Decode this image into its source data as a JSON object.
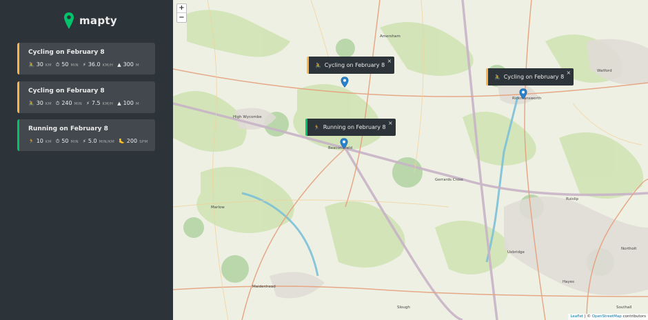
{
  "app": {
    "name": "mapty",
    "accent_cycling": "#ffb545",
    "accent_running": "#00c46a",
    "sidebar_bg": "#2d3439",
    "card_bg": "#42484d"
  },
  "workouts": [
    {
      "type": "cycling",
      "title": "Cycling on February 8",
      "details": [
        {
          "icon": "bike-icon",
          "glyph": "🚴",
          "value": "30",
          "unit": "KM"
        },
        {
          "icon": "stopwatch-icon",
          "glyph": "⏱",
          "value": "50",
          "unit": "MIN"
        },
        {
          "icon": "lightning-icon",
          "glyph": "⚡",
          "value": "36.0",
          "unit": "KM/H"
        },
        {
          "icon": "mountain-icon",
          "glyph": "▲",
          "value": "300",
          "unit": "M"
        }
      ]
    },
    {
      "type": "cycling",
      "title": "Cycling on February 8",
      "details": [
        {
          "icon": "bike-icon",
          "glyph": "🚴",
          "value": "30",
          "unit": "KM"
        },
        {
          "icon": "stopwatch-icon",
          "glyph": "⏱",
          "value": "240",
          "unit": "MIN"
        },
        {
          "icon": "lightning-icon",
          "glyph": "⚡",
          "value": "7.5",
          "unit": "KM/H"
        },
        {
          "icon": "mountain-icon",
          "glyph": "▲",
          "value": "100",
          "unit": "M"
        }
      ]
    },
    {
      "type": "running",
      "title": "Running on February 8",
      "details": [
        {
          "icon": "runner-icon",
          "glyph": "🏃",
          "value": "10",
          "unit": "KM"
        },
        {
          "icon": "stopwatch-icon",
          "glyph": "⏱",
          "value": "50",
          "unit": "MIN"
        },
        {
          "icon": "lightning-icon",
          "glyph": "⚡",
          "value": "5.0",
          "unit": "MIN/KM"
        },
        {
          "icon": "footprint-icon",
          "glyph": "🦶",
          "value": "200",
          "unit": "SPM"
        }
      ]
    }
  ],
  "map": {
    "zoom_in": "+",
    "zoom_out": "−",
    "popups": [
      {
        "type": "cycling",
        "icon": "bike-icon",
        "glyph": "🚴",
        "label": "Cycling on February 8",
        "close": "×"
      },
      {
        "type": "cycling",
        "icon": "bike-icon",
        "glyph": "🚴",
        "label": "Cycling on February 8",
        "close": "×"
      },
      {
        "type": "running",
        "icon": "runner-icon",
        "glyph": "🏃",
        "label": "Running on February 8",
        "close": "×"
      }
    ],
    "places": [
      "Amersham",
      "High Wycombe",
      "Beaconsfield",
      "Rickmansworth",
      "Watford",
      "Gerrards Cross",
      "Marlow",
      "Maidenhead",
      "Slough",
      "Uxbridge",
      "Ruislip",
      "Northolt",
      "Southall",
      "Hayes"
    ],
    "attribution": {
      "leaflet": "Leaflet",
      "sep": " | © ",
      "osm": "OpenStreetMap",
      "rest": " contributors"
    }
  }
}
